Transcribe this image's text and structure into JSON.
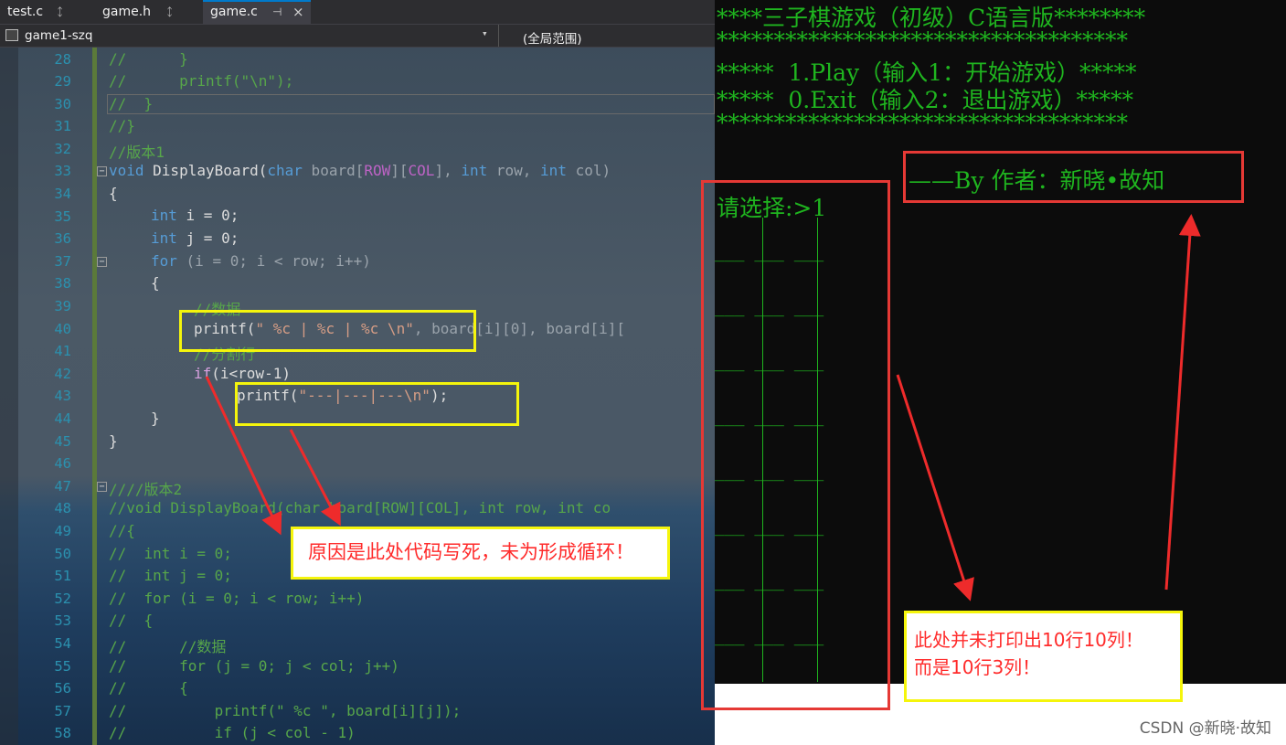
{
  "tabs": [
    {
      "label": "test.c",
      "pin": "ᛨ"
    },
    {
      "label": "game.h",
      "pin": "ᛨ"
    },
    {
      "label": "game.c",
      "pin": "⊣",
      "close": "×"
    }
  ],
  "navbar": {
    "project": "game1-szq",
    "scope": "(全局范围)"
  },
  "line_numbers": [
    "28",
    "29",
    "30",
    "31",
    "32",
    "33",
    "34",
    "35",
    "36",
    "37",
    "38",
    "39",
    "40",
    "41",
    "42",
    "43",
    "44",
    "45",
    "46",
    "47",
    "48",
    "49",
    "50",
    "51",
    "52",
    "53",
    "54",
    "55",
    "56",
    "57",
    "58"
  ],
  "code": {
    "l28": "//      }",
    "l29": "//      printf(\"\\n\");",
    "l30": "//  }",
    "l31": "//}",
    "l32": "//版本1",
    "l33_void": "void",
    "l33_name": " DisplayBoard(",
    "l33_char": "char",
    "l33_board": " board[",
    "l33_row": "ROW",
    "l33_mid": "][",
    "l33_col": "COL",
    "l33_end": "], ",
    "l33_int1": "int",
    "l33_rowp": " row, ",
    "l33_int2": "int",
    "l33_colp": " col)",
    "l34": "{",
    "l35_kw": "int",
    "l35_rest": " i = 0;",
    "l36_kw": "int",
    "l36_rest": " j = 0;",
    "l37_kw": "for",
    "l37_rest": " (i = 0; i < row; i++)",
    "l38": "{",
    "l39": "//数据",
    "l40_fn": "printf(",
    "l40_str": "\" %c | %c | %c \\n\"",
    "l40_rest": ", board[i][0], board[i][",
    "l41": "//分割行",
    "l42_kw": "if",
    "l42_rest": "(i<row-1)",
    "l43_fn": "printf(",
    "l43_str": "\"---|---|---\\n\"",
    "l43_rest": ");",
    "l44": "}",
    "l45": "}",
    "l46": "",
    "l47": "////版本2",
    "l48": "//void DisplayBoard(char board[ROW][COL], int row, int co",
    "l49": "//{",
    "l50": "//  int i = 0;",
    "l51": "//  int j = 0;",
    "l52": "//  for (i = 0; i < row; i++)",
    "l53": "//  {",
    "l54": "//      //数据",
    "l55": "//      for (j = 0; j < col; j++)",
    "l56": "//      {",
    "l57": "//          printf(\" %c \", board[i][j]);",
    "l58": "//          if (j < col - 1)"
  },
  "console": {
    "line1": "****三子棋游戏（初级）C语言版********",
    "line2": "************************************",
    "line3": "*****  1.Play（输入1：开始游戏）*****",
    "line4": "*****  0.Exit（输入2：退出游戏）*****",
    "line5": "************************************",
    "author": "——By 作者：新晓•故知",
    "prompt": "请选择:>1",
    "board_row": "___ ___ ___"
  },
  "annotations": {
    "note1": "原因是此处代码写死，未为形成循环！",
    "note2_line1": "此处并未打印出10行10列！",
    "note2_line2": "而是10行3列！"
  },
  "watermark": "CSDN @新晓·故知",
  "colors": {
    "highlight": "#f5f50c",
    "alert": "#e53935",
    "console_text": "#1fb51f"
  }
}
